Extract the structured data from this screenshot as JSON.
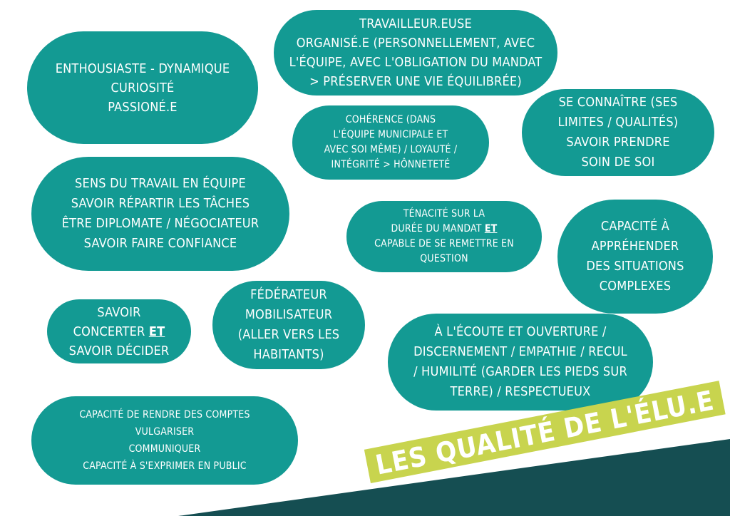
{
  "colors": {
    "bubble": "#139a93",
    "bubble_text": "#ffffff",
    "footer_band": "#154e52",
    "title_banner": "#c8d44e",
    "title_text": "#ffffff"
  },
  "title": "LES QUALITÉ DE L'ÉLU.E",
  "bubbles": [
    {
      "lines": [
        "ENTHOUSIASTE - DYNAMIQUE",
        "CURIOSITÉ",
        "PASSIONÉ.E"
      ]
    },
    {
      "lines": [
        "TRAVAILLEUR.EUSE",
        "ORGANISÉ.E (PERSONNELLEMENT, AVEC",
        "L'ÉQUIPE, AVEC L'OBLIGATION DU MANDAT",
        "> PRÉSERVER UNE VIE ÉQUILIBRÉE)"
      ]
    },
    {
      "lines": [
        "COHÉRENCE (DANS",
        "L'ÉQUIPE MUNICIPALE ET",
        "AVEC SOI MÊME) / LOYAUTÉ /",
        "INTÉGRITÉ > HÔNNETETÉ"
      ]
    },
    {
      "lines": [
        "SE CONNAÎTRE (SES",
        "LIMITES / QUALITÉS)",
        "SAVOIR PRENDRE",
        "SOIN DE SOI"
      ]
    },
    {
      "lines": [
        "SENS DU TRAVAIL EN ÉQUIPE",
        "SAVOIR RÉPARTIR LES TÂCHES",
        "ÊTRE DIPLOMATE / NÉGOCIATEUR",
        "SAVOIR FAIRE CONFIANCE"
      ]
    },
    {
      "lines": [
        "TÉNACITÉ SUR LA",
        "DURÉE DU MANDAT",
        "CAPABLE DE SE REMETTRE EN",
        "QUESTION"
      ],
      "emphasis": "ET"
    },
    {
      "lines": [
        "CAPACITÉ À",
        "APPRÉHENDER",
        "DES SITUATIONS",
        "COMPLEXES"
      ]
    },
    {
      "lines": [
        "SAVOIR",
        "CONCERTER",
        "SAVOIR DÉCIDER"
      ],
      "emphasis": "ET"
    },
    {
      "lines": [
        "FÉDÉRATEUR",
        "MOBILISATEUR",
        "(ALLER VERS LES",
        "HABITANTS)"
      ]
    },
    {
      "lines": [
        "À L'ÉCOUTE ET OUVERTURE /",
        "DISCERNEMENT / EMPATHIE / RECUL",
        "/ HUMILITÉ (GARDER LES PIEDS SUR",
        "TERRE) / RESPECTUEUX"
      ]
    },
    {
      "lines": [
        "CAPACITÉ DE RENDRE DES COMPTES",
        "VULGARISER",
        "COMMUNIQUER",
        "CAPACITÉ À S'EXPRIMER EN PUBLIC"
      ]
    }
  ]
}
